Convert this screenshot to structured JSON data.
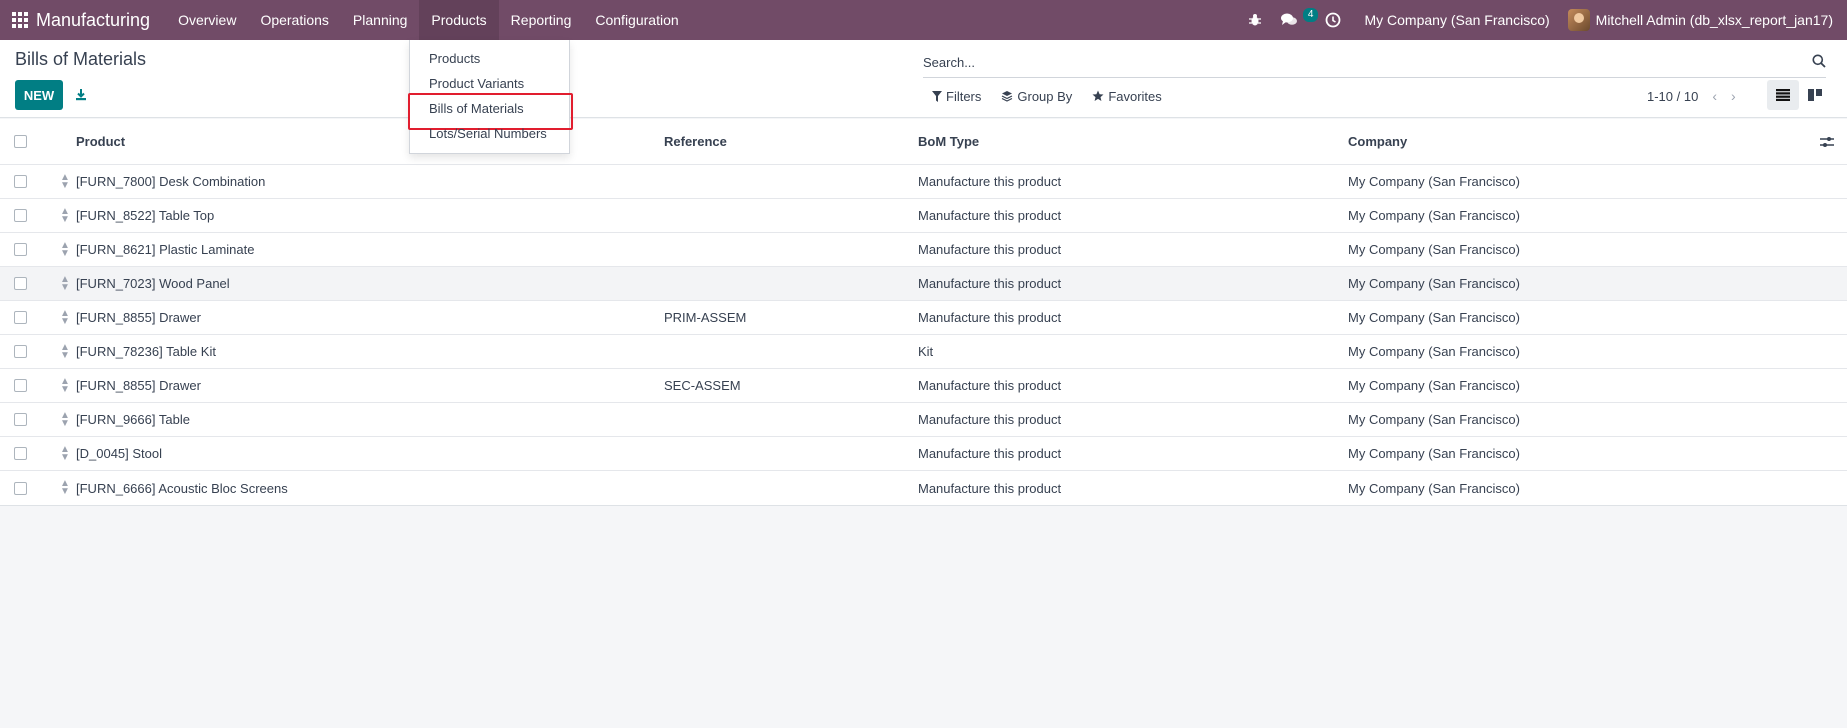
{
  "navbar": {
    "app_title": "Manufacturing",
    "menu": [
      "Overview",
      "Operations",
      "Planning",
      "Products",
      "Reporting",
      "Configuration"
    ],
    "active_menu": "Products",
    "messages_count": "4",
    "company": "My Company (San Francisco)",
    "user": "Mitchell Admin (db_xlsx_report_jan17)",
    "color": "#714b67"
  },
  "dropdown": {
    "items": [
      "Products",
      "Product Variants",
      "Bills of Materials",
      "Lots/Serial Numbers"
    ],
    "highlighted": "Bills of Materials"
  },
  "control": {
    "title": "Bills of Materials",
    "new_label": "NEW",
    "search_placeholder": "Search...",
    "filters_label": "Filters",
    "groupby_label": "Group By",
    "favorites_label": "Favorites",
    "pager": "1-10 / 10",
    "accent": "#017e84"
  },
  "table": {
    "columns": [
      "Product",
      "Reference",
      "BoM Type",
      "Company"
    ],
    "rows": [
      {
        "product": "[FURN_7800] Desk Combination",
        "reference": "",
        "type": "Manufacture this product",
        "company": "My Company (San Francisco)"
      },
      {
        "product": "[FURN_8522] Table Top",
        "reference": "",
        "type": "Manufacture this product",
        "company": "My Company (San Francisco)"
      },
      {
        "product": "[FURN_8621] Plastic Laminate",
        "reference": "",
        "type": "Manufacture this product",
        "company": "My Company (San Francisco)"
      },
      {
        "product": "[FURN_7023] Wood Panel",
        "reference": "",
        "type": "Manufacture this product",
        "company": "My Company (San Francisco)"
      },
      {
        "product": "[FURN_8855] Drawer",
        "reference": "PRIM-ASSEM",
        "type": "Manufacture this product",
        "company": "My Company (San Francisco)"
      },
      {
        "product": "[FURN_78236] Table Kit",
        "reference": "",
        "type": "Kit",
        "company": "My Company (San Francisco)"
      },
      {
        "product": "[FURN_8855] Drawer",
        "reference": "SEC-ASSEM",
        "type": "Manufacture this product",
        "company": "My Company (San Francisco)"
      },
      {
        "product": "[FURN_9666] Table",
        "reference": "",
        "type": "Manufacture this product",
        "company": "My Company (San Francisco)"
      },
      {
        "product": "[D_0045] Stool",
        "reference": "",
        "type": "Manufacture this product",
        "company": "My Company (San Francisco)"
      },
      {
        "product": "[FURN_6666] Acoustic Bloc Screens",
        "reference": "",
        "type": "Manufacture this product",
        "company": "My Company (San Francisco)"
      }
    ]
  }
}
